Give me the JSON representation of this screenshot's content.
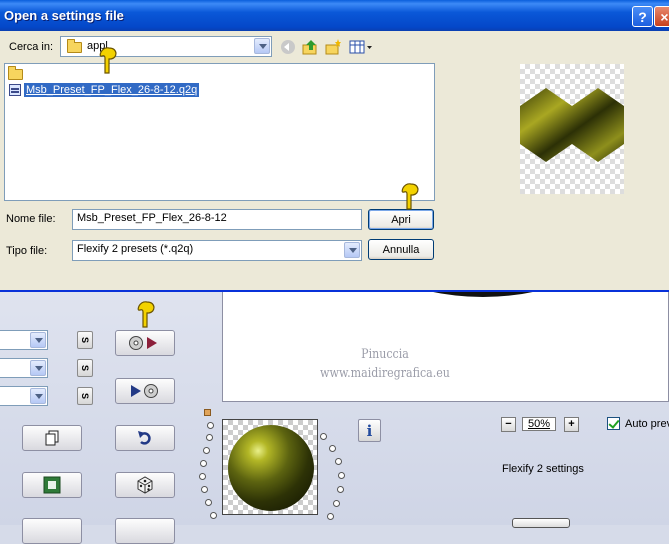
{
  "dialog": {
    "title": "Open a settings file",
    "help_label": "?",
    "close_label": "×",
    "look_in_label": "Cerca in:",
    "look_in_value": "appl",
    "selected_file": "Msb_Preset_FP_Flex_26-8-12.q2q",
    "file_name_label": "Nome file:",
    "file_name_value": "Msb_Preset_FP_Flex_26-8-12",
    "file_type_label": "Tipo file:",
    "file_type_value": "Flexify 2 presets (*.q2q)",
    "open_label": "Apri",
    "cancel_label": "Annulla"
  },
  "plugin": {
    "s_label": "S",
    "signature_line1": "Pinuccia",
    "signature_line2": "www.maidiregrafica.eu",
    "info_label": "i",
    "zoom_minus": "−",
    "zoom_value": "50%",
    "zoom_plus": "+",
    "auto_preview_label": "Auto previ",
    "settings_name": "Flexify 2 settings"
  },
  "colors": {
    "titlebar": "#0a58d8",
    "selection": "#316ac5",
    "dialog_bg": "#ece9d8",
    "plugin_bg": "#d6dbe9"
  }
}
